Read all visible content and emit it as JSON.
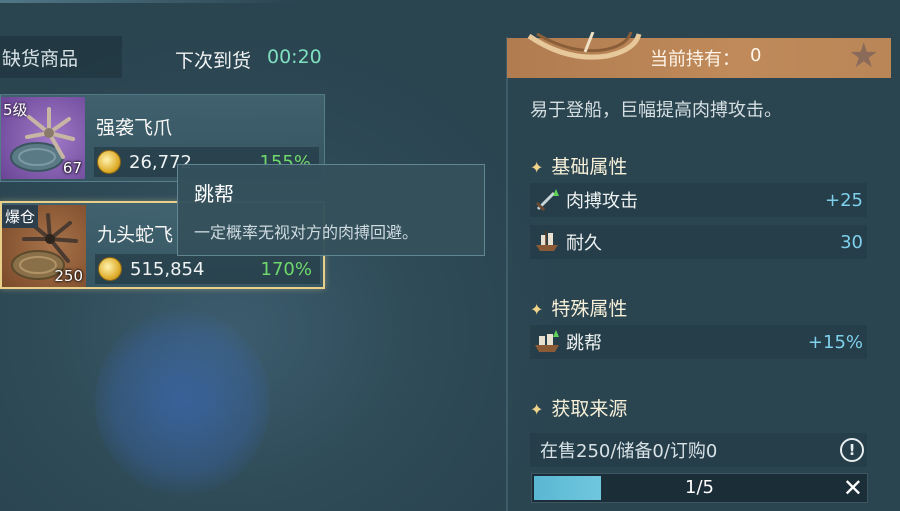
{
  "header": {
    "shortage_tab": "缺货商品",
    "restock_label": "下次到货",
    "restock_time": "00:20"
  },
  "items": [
    {
      "tag": "5级",
      "name": "强袭飞爪",
      "qty": "67",
      "price": "26,772",
      "percent": "155%",
      "color": "#8e62b8"
    },
    {
      "tag": "爆仓",
      "name": "九头蛇飞",
      "qty": "250",
      "price": "515,854",
      "percent": "170%",
      "color": "#9a6644"
    }
  ],
  "tooltip": {
    "title": "跳帮",
    "description": "一定概率无视对方的肉搏回避。"
  },
  "detail": {
    "hold_label": "当前持有：",
    "hold_value": "0",
    "description": "易于登船，巨幅提高肉搏攻击。",
    "base_title": "基础属性",
    "base_attrs": [
      {
        "icon": "melee-attack-icon",
        "name": "肉搏攻击",
        "value": "+25"
      },
      {
        "icon": "durability-icon",
        "name": "耐久",
        "value": "30"
      }
    ],
    "special_title": "特殊属性",
    "special_attrs": [
      {
        "icon": "boarding-icon",
        "name": "跳帮",
        "value": "+15%"
      }
    ],
    "source_title": "获取来源",
    "source_text": "在售250/储备0/订购0",
    "progress_text": "1/5",
    "progress_value": 0.2
  },
  "colors": {
    "accent_gold": "#e8cf8a",
    "percent_green": "#6fd96b",
    "value_blue": "#7fd0ec",
    "timer_green": "#7fe0c0"
  }
}
